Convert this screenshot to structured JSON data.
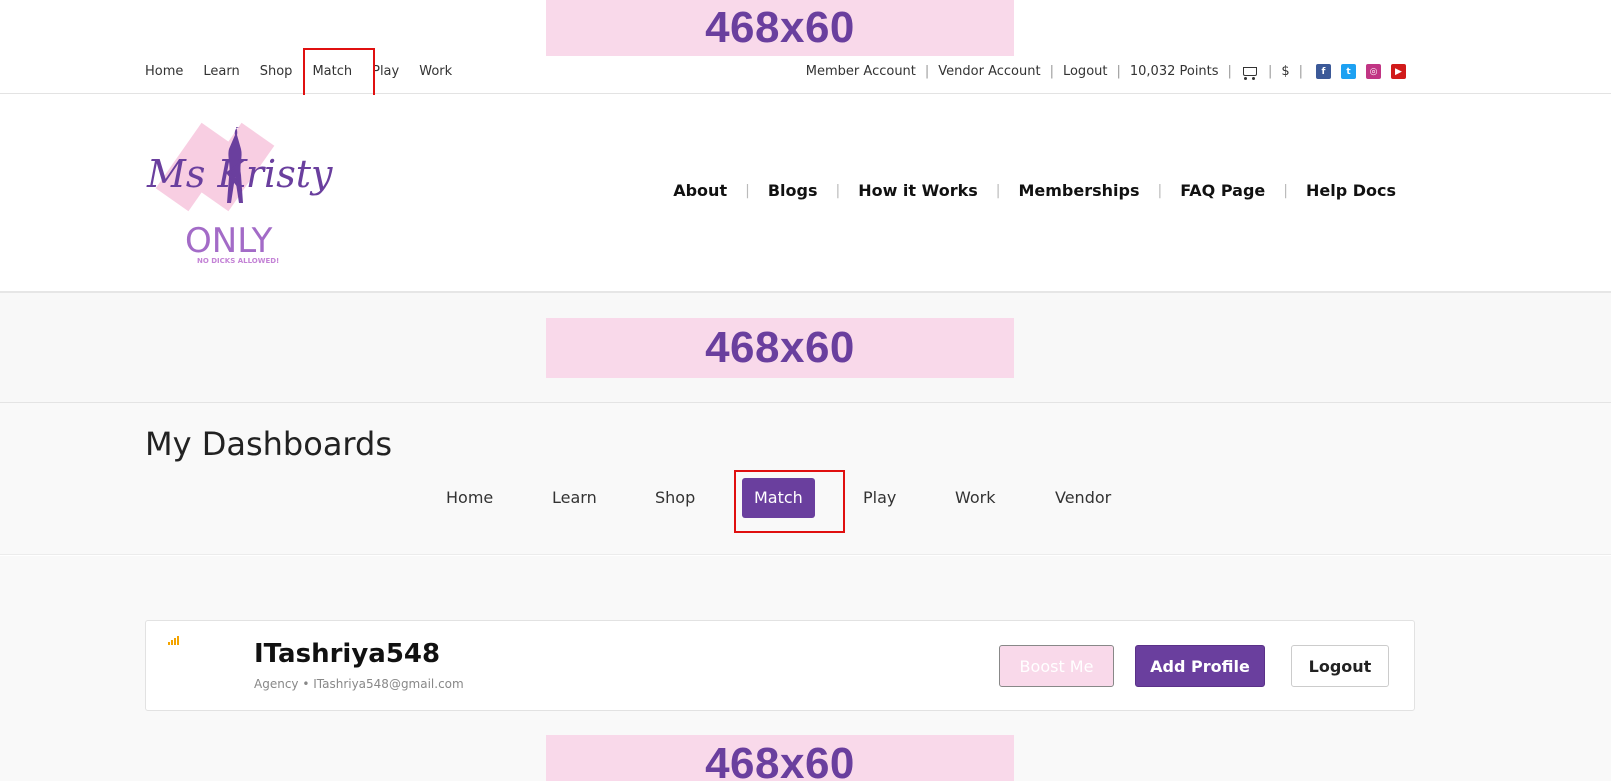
{
  "ads": {
    "top": "468x60",
    "middle": "468x60",
    "bottom": "468x60"
  },
  "topnav": [
    "Home",
    "Learn",
    "Shop",
    "Match",
    "Play",
    "Work"
  ],
  "account": {
    "member": "Member Account",
    "vendor": "Vendor Account",
    "logout": "Logout",
    "points": "10,032 Points",
    "currency": "$"
  },
  "social": [
    "facebook-icon",
    "twitter-icon",
    "instagram-icon",
    "youtube-icon"
  ],
  "logo": {
    "script": "Ms Kristy's",
    "word": "ONLY",
    "tagline": "NO DICKS ALLOWED!"
  },
  "mainnav": [
    "About",
    "Blogs",
    "How it Works",
    "Memberships",
    "FAQ Page",
    "Help Docs"
  ],
  "dashboard": {
    "title": "My Dashboards",
    "tabs": [
      "Home",
      "Learn",
      "Shop",
      "Match",
      "Play",
      "Work",
      "Vendor"
    ],
    "active_tab": "Match"
  },
  "profile": {
    "username": "ITashriya548",
    "subtitle": "Agency • ITashriya548@gmail.com",
    "boost": "Boost Me",
    "add": "Add Profile",
    "logout": "Logout"
  },
  "colors": {
    "brand_purple": "#6a3f9e",
    "ad_pink": "#f9d9ea",
    "highlight_red": "#e01010"
  }
}
